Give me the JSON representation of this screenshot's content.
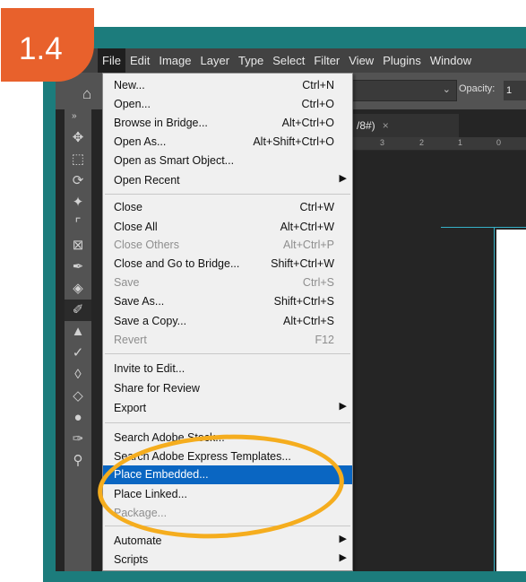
{
  "step_badge": "1.4",
  "menubar": {
    "items": [
      "File",
      "Edit",
      "Image",
      "Layer",
      "Type",
      "Select",
      "Filter",
      "View",
      "Plugins",
      "Window"
    ]
  },
  "options_bar": {
    "opacity_label": "Opacity:",
    "opacity_value": "1"
  },
  "document_tab": {
    "title": "/8#)",
    "close": "×"
  },
  "ruler_ticks": [
    "3",
    "2",
    "1",
    "0"
  ],
  "file_menu": {
    "items": [
      {
        "label": "New...",
        "shortcut": "Ctrl+N"
      },
      {
        "label": "Open...",
        "shortcut": "Ctrl+O"
      },
      {
        "label": "Browse in Bridge...",
        "shortcut": "Alt+Ctrl+O"
      },
      {
        "label": "Open As...",
        "shortcut": "Alt+Shift+Ctrl+O"
      },
      {
        "label": "Open as Smart Object...",
        "shortcut": ""
      },
      {
        "label": "Open Recent",
        "shortcut": ""
      },
      {
        "label": "Close",
        "shortcut": "Ctrl+W"
      },
      {
        "label": "Close All",
        "shortcut": "Alt+Ctrl+W"
      },
      {
        "label": "Close Others",
        "shortcut": "Alt+Ctrl+P"
      },
      {
        "label": "Close and Go to Bridge...",
        "shortcut": "Shift+Ctrl+W"
      },
      {
        "label": "Save",
        "shortcut": "Ctrl+S"
      },
      {
        "label": "Save As...",
        "shortcut": "Shift+Ctrl+S"
      },
      {
        "label": "Save a Copy...",
        "shortcut": "Alt+Ctrl+S"
      },
      {
        "label": "Revert",
        "shortcut": "F12"
      },
      {
        "label": "Invite to Edit...",
        "shortcut": ""
      },
      {
        "label": "Share for Review",
        "shortcut": ""
      },
      {
        "label": "Export",
        "shortcut": ""
      },
      {
        "label": "Search Adobe Stock...",
        "shortcut": ""
      },
      {
        "label": "Search Adobe Express Templates...",
        "shortcut": ""
      },
      {
        "label": "Place Embedded...",
        "shortcut": ""
      },
      {
        "label": "Place Linked...",
        "shortcut": ""
      },
      {
        "label": "Package...",
        "shortcut": ""
      },
      {
        "label": "Automate",
        "shortcut": ""
      },
      {
        "label": "Scripts",
        "shortcut": ""
      }
    ]
  },
  "tools": [
    "move-tool-icon",
    "marquee-tool-icon",
    "lasso-tool-icon",
    "magic-wand-icon",
    "crop-tool-icon",
    "frame-tool-icon",
    "eyedropper-icon",
    "healing-brush-icon",
    "brush-tool-icon",
    "clone-stamp-icon",
    "history-brush-icon",
    "eraser-icon",
    "gradient-tool-icon",
    "blur-tool-icon",
    "pen-tool-icon",
    "dodge-tool-icon"
  ],
  "colors": {
    "frame": "#1c7c7c",
    "badge": "#e8612c",
    "highlight_ring": "#f5ad1e",
    "menu_selection": "#0a66c2"
  }
}
